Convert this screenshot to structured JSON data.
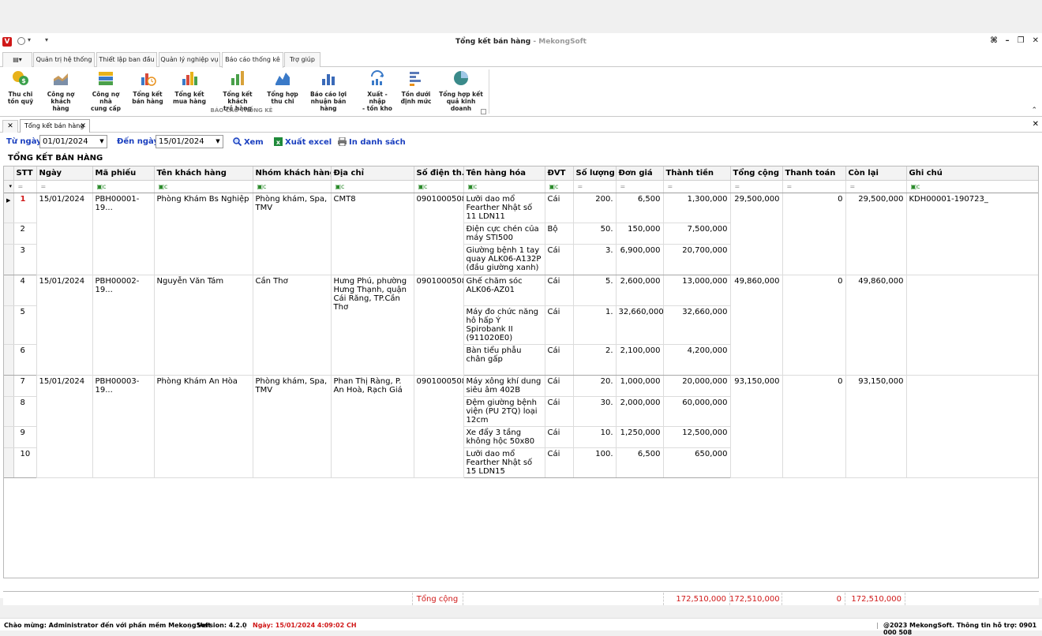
{
  "titlebar": {
    "title": "Tổng kết bán hàng",
    "title_suffix": " - MekongSoft",
    "logo": "V"
  },
  "tabs": [
    {
      "label": "Quản trị hệ thống"
    },
    {
      "label": "Thiết lập ban đầu"
    },
    {
      "label": "Quản lý nghiệp vụ"
    },
    {
      "label": "Báo cáo thống kê"
    },
    {
      "label": "Trợ giúp"
    }
  ],
  "ribbon": {
    "group_label": "BÁO CÁO THỐNG KÊ",
    "buttons": [
      {
        "line1": "Thu chi",
        "line2": "tồn quỹ",
        "icon": "coins-icon"
      },
      {
        "line1": "Công nợ",
        "line2": "khách hàng",
        "icon": "area-chart-icon"
      },
      {
        "line1": "Công nợ nhà",
        "line2": "cung cấp",
        "icon": "stacked-chart-icon"
      },
      {
        "line1": "Tổng kết",
        "line2": "bán hàng",
        "icon": "bar-clock-icon"
      },
      {
        "line1": "Tổng kết",
        "line2": "mua hàng",
        "icon": "bar-chart-icon"
      },
      {
        "line1": "Tổng kết khách",
        "line2": "trả hàng",
        "icon": "green-bar-icon"
      },
      {
        "line1": "Tổng hợp",
        "line2": "thu chi",
        "icon": "line-chart-icon"
      },
      {
        "line1": "Báo cáo lợi",
        "line2": "nhuận bán hàng",
        "icon": "profit-chart-icon"
      },
      {
        "line1": "Xuất - nhập",
        "line2": "- tồn kho",
        "icon": "refresh-chart-icon"
      },
      {
        "line1": "Tồn dưới",
        "line2": "định mức",
        "icon": "list-chart-icon"
      },
      {
        "line1": "Tổng hợp kết",
        "line2": "quả kinh doanh",
        "icon": "pie-chart-icon"
      }
    ]
  },
  "doc_tab": {
    "label": "Tổng kết bán hàng"
  },
  "filter": {
    "from_label": "Từ ngày",
    "from_value": "01/01/2024",
    "to_label": "Đến ngày",
    "to_value": "15/01/2024",
    "view_label": "Xem",
    "excel_label": "Xuất excel",
    "print_label": "In danh sách"
  },
  "section_title": "TỔNG KẾT BÁN HÀNG",
  "columns": [
    "STT",
    "Ngày",
    "Mã phiếu",
    "Tên khách hàng",
    "Nhóm khách hàng",
    "Địa chỉ",
    "Số điện th...",
    "Tên hàng hóa",
    "ĐVT",
    "Số lượng",
    "Đơn giá",
    "Thành tiền",
    "Tổng cộng",
    "Thanh toán",
    "Còn lại",
    "Ghi chú"
  ],
  "groups": [
    {
      "date": "15/01/2024",
      "code": "PBH00001-19...",
      "customer": "Phòng Khám Bs Nghiệp",
      "group": "Phòng khám, Spa, TMV",
      "address": "CMT8",
      "phone": "0901000508",
      "total": "29,500,000",
      "paid": "0",
      "remain": "29,500,000",
      "note": "KDH00001-190723_",
      "items": [
        {
          "stt": "1",
          "name": "Lưỡi dao mổ Fearther Nhật số 11 LDN11",
          "unit": "Cái",
          "qty": "200.",
          "price": "6,500",
          "amount": "1,300,000"
        },
        {
          "stt": "2",
          "name": "Điện cực chén của máy STI500",
          "unit": "Bộ",
          "qty": "50.",
          "price": "150,000",
          "amount": "7,500,000"
        },
        {
          "stt": "3",
          "name": "Giường bệnh 1 tay quay ALK06-A132P (đầu giường xanh)",
          "unit": "Cái",
          "qty": "3.",
          "price": "6,900,000",
          "amount": "20,700,000"
        }
      ]
    },
    {
      "date": "15/01/2024",
      "code": "PBH00002-19...",
      "customer": "Nguyễn Văn Tám",
      "group": "Cần Thơ",
      "address": "Hưng Phú, phường Hưng Thạnh, quận Cái Răng, TP.Cần Thơ",
      "phone": "0901000508",
      "total": "49,860,000",
      "paid": "0",
      "remain": "49,860,000",
      "note": "",
      "items": [
        {
          "stt": "4",
          "name": "Ghế chăm sóc ALK06-AZ01",
          "unit": "Cái",
          "qty": "5.",
          "price": "2,600,000",
          "amount": "13,000,000"
        },
        {
          "stt": "5",
          "name": "Máy đo chức năng hô hấp Ý Spirobank II (911020E0)",
          "unit": "Cái",
          "qty": "1.",
          "price": "32,660,000",
          "amount": "32,660,000"
        },
        {
          "stt": "6",
          "name": "Bàn tiểu phẫu chân gấp",
          "unit": "Cái",
          "qty": "2.",
          "price": "2,100,000",
          "amount": "4,200,000"
        }
      ]
    },
    {
      "date": "15/01/2024",
      "code": "PBH00003-19...",
      "customer": "Phòng Khám An Hòa",
      "group": "Phòng khám, Spa, TMV",
      "address": "Phan Thị Ràng, P. An Hoà, Rạch Giá",
      "phone": "0901000508",
      "total": "93,150,000",
      "paid": "0",
      "remain": "93,150,000",
      "note": "",
      "items": [
        {
          "stt": "7",
          "name": "Máy xông khí dung siêu âm 402B",
          "unit": "Cái",
          "qty": "20.",
          "price": "1,000,000",
          "amount": "20,000,000"
        },
        {
          "stt": "8",
          "name": "Đệm giường bệnh viện (PU 2TQ) loại 12cm",
          "unit": "Cái",
          "qty": "30.",
          "price": "2,000,000",
          "amount": "60,000,000"
        },
        {
          "stt": "9",
          "name": "Xe đẩy 3 tầng không hộc 50x80",
          "unit": "Cái",
          "qty": "10.",
          "price": "1,250,000",
          "amount": "12,500,000"
        },
        {
          "stt": "10",
          "name": "Lưỡi dao mổ Fearther Nhật số 15 LDN15",
          "unit": "Cái",
          "qty": "100.",
          "price": "6,500",
          "amount": "650,000"
        }
      ]
    }
  ],
  "footer": {
    "label": "Tổng cộng",
    "amount": "172,510,000",
    "total": "172,510,000",
    "paid": "0",
    "remain": "172,510,000"
  },
  "status": {
    "welcome": "Chào mừng: Administrator đến với phần mềm MekongSoft",
    "version": "Version: 4.2.0",
    "date": "Ngày: 15/01/2024 4:09:02 CH",
    "copyright": "@2023 MekongSoft. Thông tin hỗ trợ: 0901 000 508"
  },
  "colors": {
    "accent_blue": "#1a3fbf",
    "red": "#d01818"
  }
}
